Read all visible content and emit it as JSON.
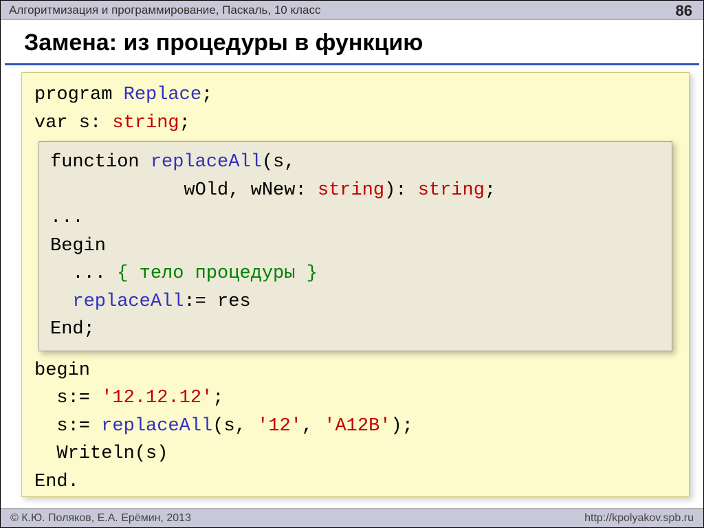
{
  "header": {
    "breadcrumb": "Алгоритмизация и программирование, Паскаль, 10 класс",
    "page_number": "86"
  },
  "title": "Замена: из процедуры в функцию",
  "code": {
    "l1_kw": "program ",
    "l1_fn": "Replace",
    "l1_end": ";",
    "l2_kw": "var s: ",
    "l2_typ": "string",
    "l2_end": ";",
    "inner": {
      "l1_kw": "function ",
      "l1_fn": "replaceAll",
      "l1_rest": "(s,",
      "l2_indent": "            wOld, wNew: ",
      "l2_typ1": "string",
      "l2_mid": "): ",
      "l2_typ2": "string",
      "l2_end": ";",
      "l3": "...",
      "l4": "Begin",
      "l5_pre": "  ... ",
      "l5_cmt": "{ тело процедуры }",
      "l6_pre": "  ",
      "l6_fn": "replaceAll",
      "l6_rest": ":= res",
      "l7": "End;"
    },
    "l_begin": "begin",
    "l_s1_pre": "  s:= ",
    "l_s1_str": "'12.12.12'",
    "l_s1_end": ";",
    "l_s2_pre": "  s:= ",
    "l_s2_fn": "replaceAll",
    "l_s2_mid1": "(s, ",
    "l_s2_str1": "'12'",
    "l_s2_mid2": ", ",
    "l_s2_str2": "'A12B'",
    "l_s2_end": ");",
    "l_w": "  Writeln(s)",
    "l_end": "End."
  },
  "footer": {
    "copyright": "© К.Ю. Поляков, Е.А. Ерёмин, 2013",
    "url": "http://kpolyakov.spb.ru"
  }
}
